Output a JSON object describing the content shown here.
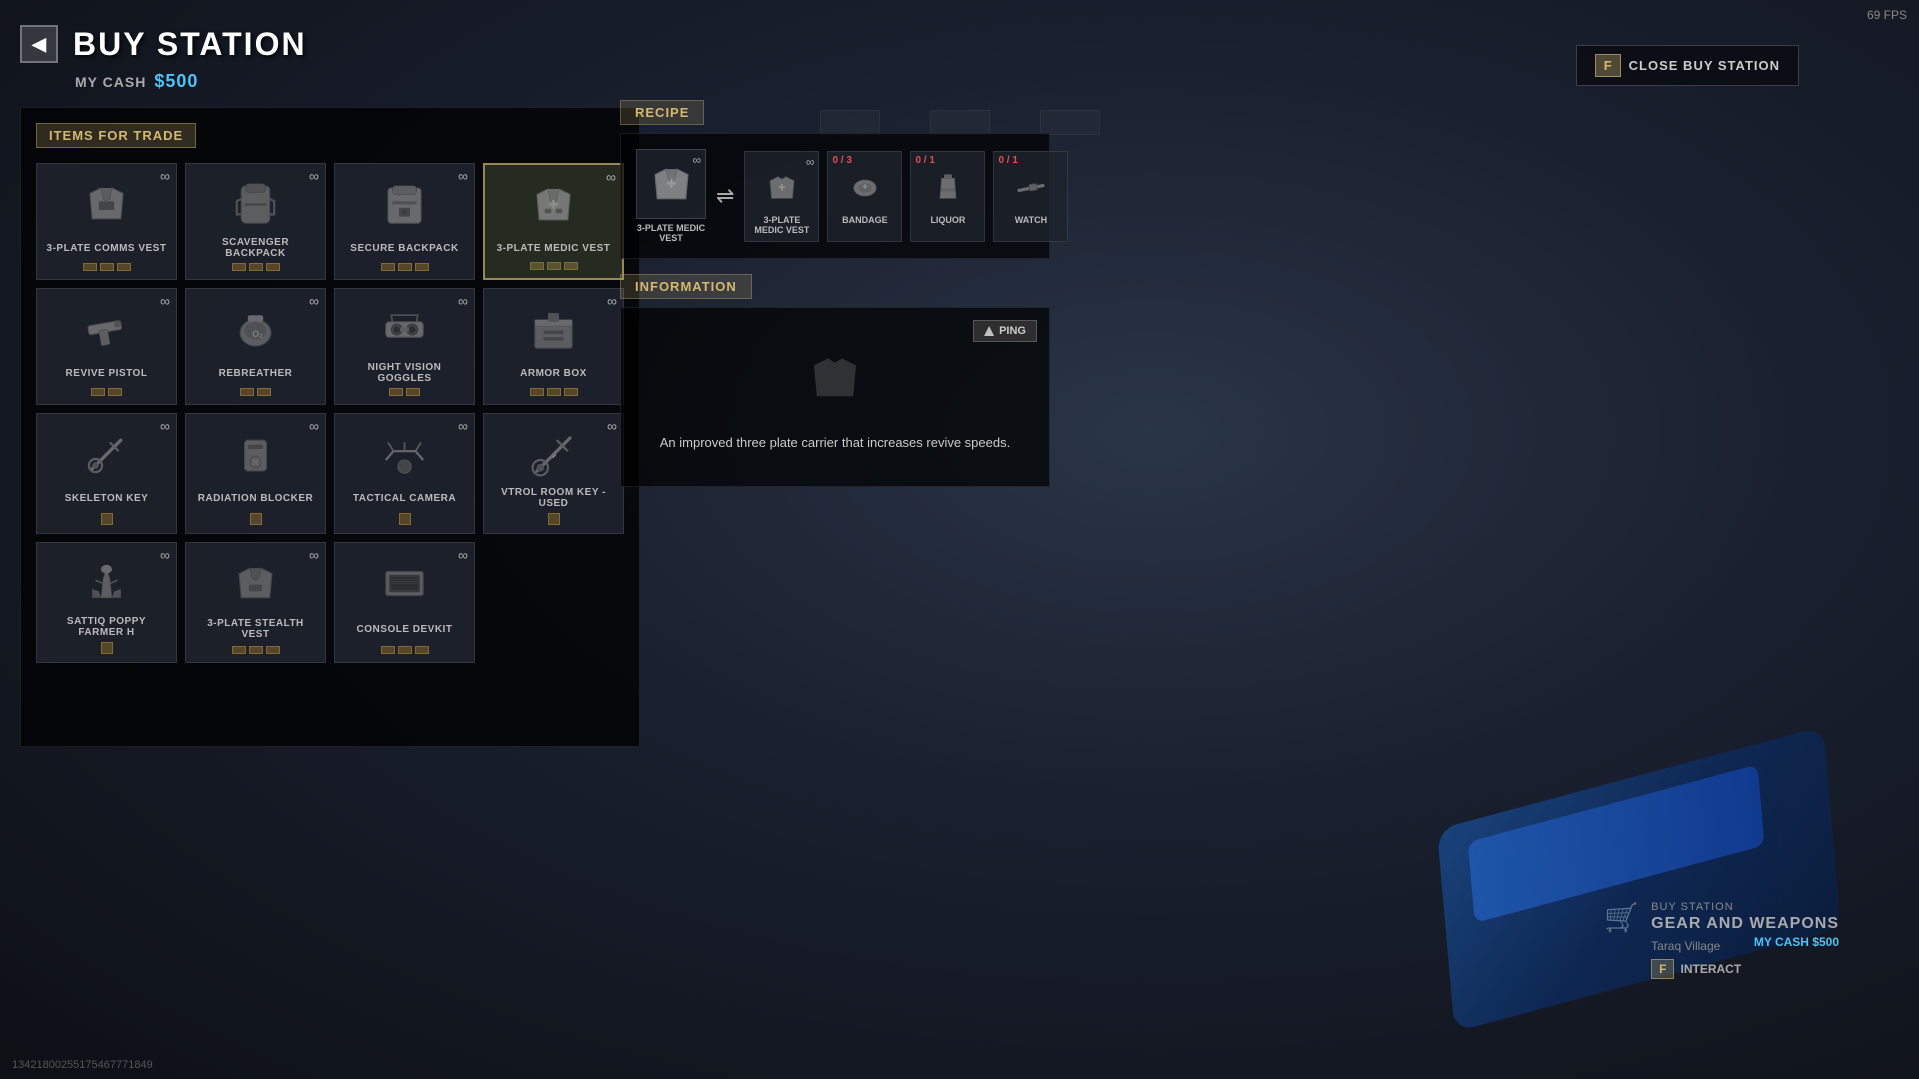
{
  "meta": {
    "fps": "69 FPS",
    "session_id": "13421800255175467771849"
  },
  "header": {
    "title": "BUY STATION",
    "back_label": "◀",
    "cash_label": "MY CASH",
    "cash_amount": "$500"
  },
  "close_button": {
    "key": "F",
    "label": "CLOSE BUY STATION"
  },
  "items_section": {
    "header": "ITEMS FOR TRADE",
    "items": [
      {
        "name": "3-PLATE COMMS VEST",
        "infinity": true,
        "slots": 3,
        "selected": false
      },
      {
        "name": "SCAVENGER BACKPACK",
        "infinity": true,
        "slots": 3,
        "selected": false
      },
      {
        "name": "SECURE BACKPACK",
        "infinity": true,
        "slots": 3,
        "selected": false
      },
      {
        "name": "3-PLATE MEDIC VEST",
        "infinity": true,
        "slots": 3,
        "selected": true
      },
      {
        "name": "REVIVE PISTOL",
        "infinity": true,
        "slots": 2,
        "selected": false
      },
      {
        "name": "REBREATHER",
        "infinity": true,
        "slots": 2,
        "selected": false
      },
      {
        "name": "NIGHT VISION GOGGLES",
        "infinity": true,
        "slots": 2,
        "selected": false
      },
      {
        "name": "ARMOR BOX",
        "infinity": true,
        "slots": 3,
        "selected": false
      },
      {
        "name": "SKELETON KEY",
        "infinity": true,
        "slots": 1,
        "selected": false
      },
      {
        "name": "RADIATION BLOCKER",
        "infinity": true,
        "slots": 1,
        "selected": false
      },
      {
        "name": "TACTICAL CAMERA",
        "infinity": true,
        "slots": 1,
        "selected": false
      },
      {
        "name": "VTROL ROOM KEY - USED",
        "infinity": true,
        "slots": 1,
        "selected": false
      },
      {
        "name": "SATTIQ POPPY FARMER H",
        "infinity": true,
        "slots": 1,
        "selected": false
      },
      {
        "name": "3-PLATE STEALTH VEST",
        "infinity": true,
        "slots": 3,
        "selected": false
      },
      {
        "name": "CONSOLE DEVKIT",
        "infinity": true,
        "slots": 3,
        "selected": false
      }
    ]
  },
  "recipe": {
    "header": "RECIPE",
    "output": {
      "name": "3-PLATE MEDIC VEST",
      "infinity": true
    },
    "inputs": [
      {
        "name": "3-PLATE MEDIC VEST",
        "count": "",
        "has_infinity": true
      },
      {
        "name": "BANDAGE",
        "count": "0 / 3"
      },
      {
        "name": "LIQUOR",
        "count": "0 / 1"
      },
      {
        "name": "WATCH",
        "count": "0 / 1"
      }
    ]
  },
  "information": {
    "header": "INFORMATION",
    "ping_label": "PING",
    "description": "An improved three plate carrier that increases revive speeds."
  },
  "buy_station_widget": {
    "label": "BUY STATION",
    "sublabel": "GEAR AND WEAPONS",
    "location": "Taraq Village",
    "cash": "MY CASH $500",
    "interact_key": "F",
    "interact_label": "INTERACT"
  }
}
